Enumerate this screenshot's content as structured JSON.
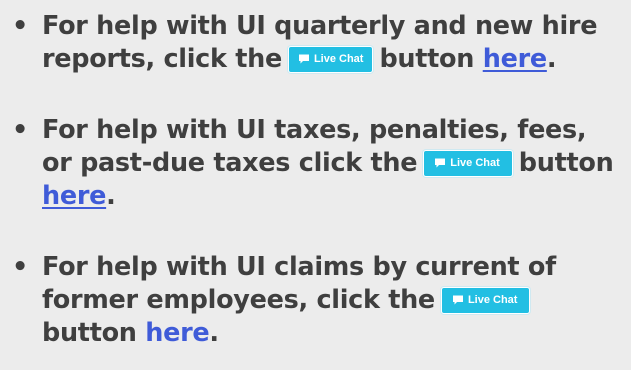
{
  "items": [
    {
      "bullet": "•",
      "text_before": "For help with UI quarterly and new hire reports, click the",
      "button_label": "Live Chat",
      "text_after": "button",
      "link_text": "here",
      "end": "."
    },
    {
      "bullet": "•",
      "text_before": "For help with UI taxes, penalties, fees, or past-due taxes click the",
      "button_label": "Live Chat",
      "text_after": "button",
      "link_text": "here",
      "end": "."
    },
    {
      "bullet": "•",
      "text_before": "For help with UI claims by current of former employees, click the",
      "button_label": "Live Chat",
      "text_after": "button",
      "link_text": "here",
      "end": "."
    }
  ],
  "colors": {
    "background": "#ececec",
    "text": "#3f3f3f",
    "link": "#3f5bd8",
    "chat_button": "#22bfe3"
  },
  "icons": {
    "chat_button_icon": "speech-bubble-icon"
  }
}
